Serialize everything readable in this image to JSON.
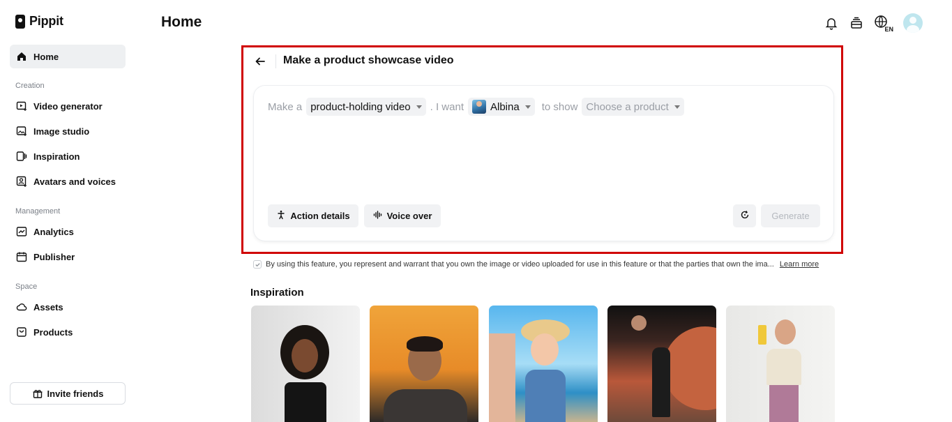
{
  "app": {
    "name": "Pippit"
  },
  "sidebar": {
    "home": "Home",
    "sections": {
      "creation": "Creation",
      "management": "Management",
      "space": "Space"
    },
    "items": {
      "video_generator": "Video generator",
      "image_studio": "Image studio",
      "inspiration": "Inspiration",
      "avatars_voices": "Avatars and voices",
      "analytics": "Analytics",
      "publisher": "Publisher",
      "assets": "Assets",
      "products": "Products"
    },
    "invite": "Invite friends"
  },
  "header": {
    "title": "Home",
    "language": "EN"
  },
  "composer": {
    "title": "Make a product showcase video",
    "prompt": {
      "prefix": "Make a",
      "video_type": "product-holding video",
      "mid": ". I want",
      "avatar": "Albina",
      "suffix": "to show",
      "product_placeholder": "Choose a product"
    },
    "buttons": {
      "action_details": "Action details",
      "voice_over": "Voice over",
      "generate": "Generate"
    }
  },
  "disclaimer": {
    "text": "By using this feature, you represent and warrant that you own the image or video uploaded for use in this feature or that the parties that own the ima...",
    "link": "Learn more"
  },
  "inspiration": {
    "title": "Inspiration"
  },
  "colors": {
    "highlight": "#d00000",
    "active_nav": "#eef0f2",
    "pill_bg": "#f1f2f4"
  }
}
